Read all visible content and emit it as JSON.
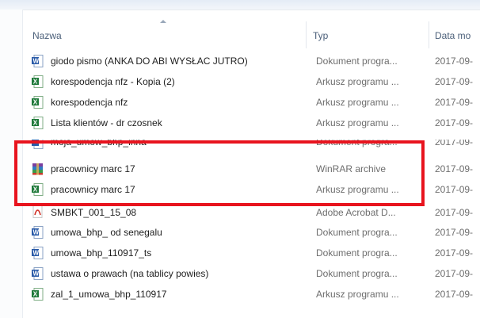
{
  "columns": {
    "name": "Nazwa",
    "type": "Typ",
    "date": "Data mo"
  },
  "colors": {
    "highlight": "#e8141e",
    "header_text": "#4c607a",
    "secondary_text": "#6d6d6d"
  },
  "files": [
    {
      "name": "giodo pismo (ANKA DO ABI WYSŁAC JUTRO)",
      "type": "Dokument progra...",
      "date": "2017-09-",
      "icon": "word-document-icon"
    },
    {
      "name": "korespodencja nfz - Kopia (2)",
      "type": "Arkusz programu ...",
      "date": "2017-09-",
      "icon": "excel-spreadsheet-icon"
    },
    {
      "name": "korespodencja nfz",
      "type": "Arkusz programu ...",
      "date": "2017-09-",
      "icon": "excel-spreadsheet-icon"
    },
    {
      "name": "Lista klientów - dr czosnek",
      "type": "Arkusz programu ...",
      "date": "2017-09-",
      "icon": "excel-spreadsheet-icon"
    },
    {
      "name": "moja_umow_bhp_inna",
      "type": "Dokument progra...",
      "date": "2017-09-",
      "icon": "word-document-icon"
    },
    {
      "name": "pracownicy marc 17",
      "type": "WinRAR archive",
      "date": "2017-09-",
      "icon": "winrar-archive-icon"
    },
    {
      "name": "pracownicy marc 17",
      "type": "Arkusz programu ...",
      "date": "2017-09-",
      "icon": "excel-spreadsheet-icon"
    },
    {
      "name": "SMBKT_001_15_08",
      "type": "Adobe Acrobat D...",
      "date": "2017-09-",
      "icon": "pdf-document-icon"
    },
    {
      "name": "umowa_bhp_ od senegalu",
      "type": "Dokument progra...",
      "date": "2017-09-",
      "icon": "word-document-icon"
    },
    {
      "name": "umowa_bhp_110917_ts",
      "type": "Dokument progra...",
      "date": "2017-09-",
      "icon": "word-document-icon"
    },
    {
      "name": "ustawa o prawach (na tablicy powies)",
      "type": "Dokument progra...",
      "date": "2017-09-",
      "icon": "word-document-icon"
    },
    {
      "name": "zal_1_umowa_bhp_110917",
      "type": "Arkusz programu ...",
      "date": "2017-09-",
      "icon": "excel-spreadsheet-icon"
    }
  ]
}
